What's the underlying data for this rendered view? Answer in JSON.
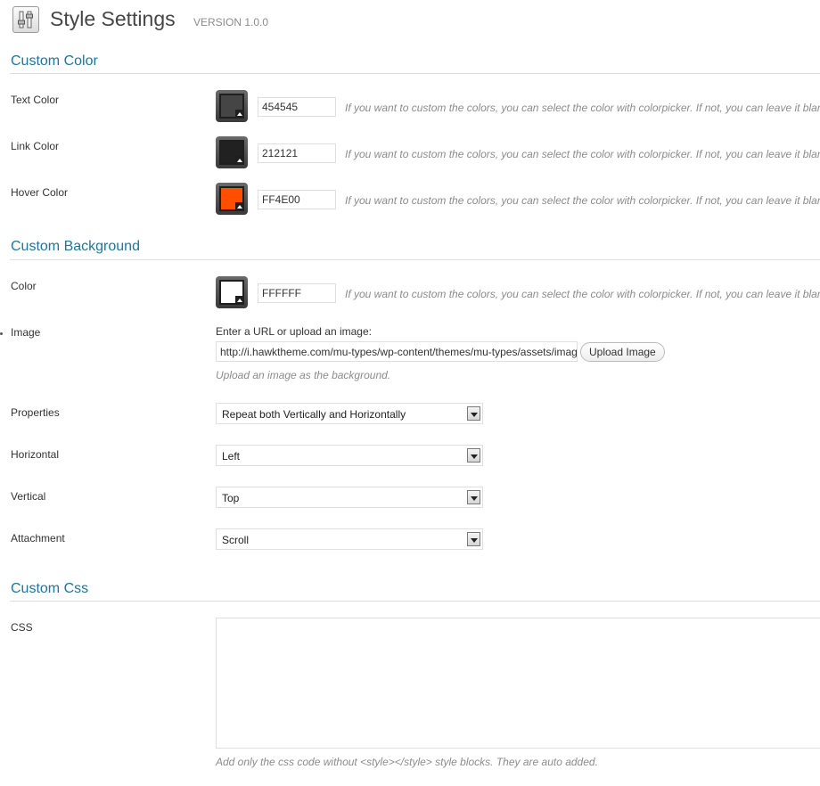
{
  "header": {
    "title": "Style Settings",
    "version": "VERSION 1.0.0",
    "icon": "settings-sliders-icon"
  },
  "custom_color": {
    "heading": "Custom Color",
    "help": "If you want to custom the colors, you can select the color with colorpicker. If not, you can leave it blank",
    "rows": [
      {
        "label": "Text Color",
        "value": "454545",
        "swatch": "#454545"
      },
      {
        "label": "Link Color",
        "value": "212121",
        "swatch": "#212121"
      },
      {
        "label": "Hover Color",
        "value": "FF4E00",
        "swatch": "#FF4E00"
      }
    ]
  },
  "custom_background": {
    "heading": "Custom Background",
    "color": {
      "label": "Color",
      "value": "FFFFFF",
      "swatch": "#FFFFFF",
      "help": "If you want to custom the colors, you can select the color with colorpicker. If not, you can leave it blank"
    },
    "image": {
      "label": "Image",
      "prompt": "Enter a URL or upload an image:",
      "url": "http://i.hawktheme.com/mu-types/wp-content/themes/mu-types/assets/images/",
      "upload_button": "Upload Image",
      "help": "Upload an image as the background."
    },
    "properties": {
      "label": "Properties",
      "value": "Repeat both Vertically and Horizontally"
    },
    "horizontal": {
      "label": "Horizontal",
      "value": "Left"
    },
    "vertical": {
      "label": "Vertical",
      "value": "Top"
    },
    "attachment": {
      "label": "Attachment",
      "value": "Scroll"
    }
  },
  "custom_css": {
    "heading": "Custom Css",
    "label": "CSS",
    "value": "",
    "help": "Add only the css code without <style></style> style blocks. They are auto added."
  },
  "colors": {
    "heading": "#21759b",
    "help_text": "#8c8c8c"
  }
}
